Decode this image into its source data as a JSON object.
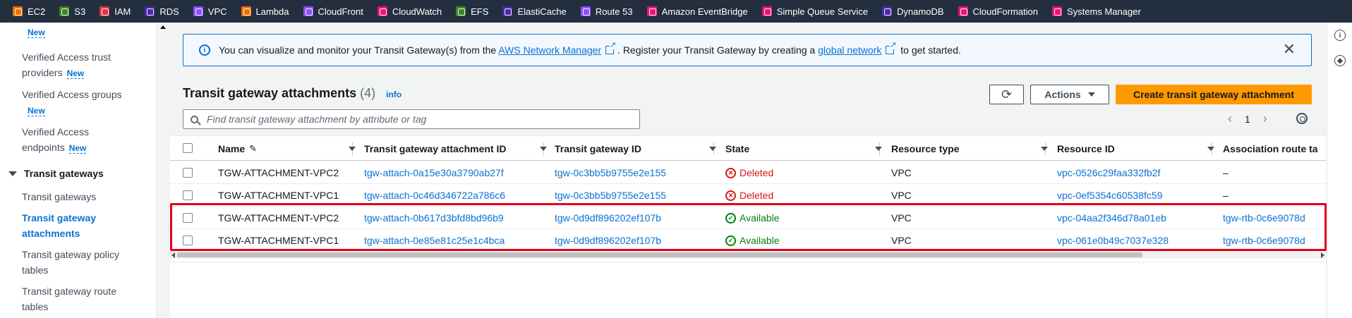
{
  "services": [
    {
      "label": "EC2",
      "color": "#ed7100",
      "icon": "ec2-icon"
    },
    {
      "label": "S3",
      "color": "#3f8624",
      "icon": "s3-icon"
    },
    {
      "label": "IAM",
      "color": "#dd344c",
      "icon": "iam-icon"
    },
    {
      "label": "RDS",
      "color": "#4d27aa",
      "icon": "rds-icon"
    },
    {
      "label": "VPC",
      "color": "#8c4fff",
      "icon": "vpc-icon"
    },
    {
      "label": "Lambda",
      "color": "#ed7100",
      "icon": "lambda-icon"
    },
    {
      "label": "CloudFront",
      "color": "#8c4fff",
      "icon": "cloudfront-icon"
    },
    {
      "label": "CloudWatch",
      "color": "#e7157b",
      "icon": "cloudwatch-icon"
    },
    {
      "label": "EFS",
      "color": "#3f8624",
      "icon": "efs-icon"
    },
    {
      "label": "ElastiCache",
      "color": "#4d27aa",
      "icon": "elasticache-icon"
    },
    {
      "label": "Route 53",
      "color": "#8c4fff",
      "icon": "route53-icon"
    },
    {
      "label": "Amazon EventBridge",
      "color": "#e7157b",
      "icon": "eventbridge-icon"
    },
    {
      "label": "Simple Queue Service",
      "color": "#e7157b",
      "icon": "sqs-icon"
    },
    {
      "label": "DynamoDB",
      "color": "#4d27aa",
      "icon": "dynamodb-icon"
    },
    {
      "label": "CloudFormation",
      "color": "#e7157b",
      "icon": "cloudformation-icon"
    },
    {
      "label": "Systems Manager",
      "color": "#e7157b",
      "icon": "systems-manager-icon"
    }
  ],
  "sidebar": {
    "new_badge": "New",
    "verified_trust_1": "Verified Access trust",
    "verified_trust_2": "providers",
    "verified_groups": "Verified Access groups",
    "verified_endpoints_1": "Verified Access",
    "verified_endpoints_2": "endpoints",
    "section": "Transit gateways",
    "item_tgw": "Transit gateways",
    "item_attach_1": "Transit gateway",
    "item_attach_2": "attachments",
    "item_policy_1": "Transit gateway policy",
    "item_policy_2": "tables",
    "item_route_1": "Transit gateway route",
    "item_route_2": "tables"
  },
  "flash": {
    "text1": "You can visualize and monitor your Transit Gateway(s) from the ",
    "link1": "AWS Network Manager",
    "text2": ". Register your Transit Gateway by creating a ",
    "link2": "global network",
    "text3": " to get started."
  },
  "header": {
    "title": "Transit gateway attachments",
    "count": "(4)",
    "info": "info",
    "actions": "Actions",
    "create": "Create transit gateway attachment"
  },
  "search": {
    "placeholder": "Find transit gateway attachment by attribute or tag"
  },
  "pager": {
    "page": "1"
  },
  "table": {
    "columns": [
      "Name",
      "Transit gateway attachment ID",
      "Transit gateway ID",
      "State",
      "Resource type",
      "Resource ID",
      "Association route ta"
    ],
    "rows": [
      {
        "name": "TGW-ATTACHMENT-VPC2",
        "attach_id": "tgw-attach-0a15e30a3790ab27f",
        "tgw_id": "tgw-0c3bb5b9755e2e155",
        "state": "Deleted",
        "rtype": "VPC",
        "rid": "vpc-0526c29faa332fb2f",
        "assoc": "–"
      },
      {
        "name": "TGW-ATTACHMENT-VPC1",
        "attach_id": "tgw-attach-0c46d346722a786c6",
        "tgw_id": "tgw-0c3bb5b9755e2e155",
        "state": "Deleted",
        "rtype": "VPC",
        "rid": "vpc-0ef5354c60538fc59",
        "assoc": "–"
      },
      {
        "name": "TGW-ATTACHMENT-VPC2",
        "attach_id": "tgw-attach-0b617d3bfd8bd96b9",
        "tgw_id": "tgw-0d9df896202ef107b",
        "state": "Available",
        "rtype": "VPC",
        "rid": "vpc-04aa2f346d78a01eb",
        "assoc": "tgw-rtb-0c6e9078d"
      },
      {
        "name": "TGW-ATTACHMENT-VPC1",
        "attach_id": "tgw-attach-0e85e81c25e1c4bca",
        "tgw_id": "tgw-0d9df896202ef107b",
        "state": "Available",
        "rtype": "VPC",
        "rid": "vpc-061e0b49c7037e328",
        "assoc": "tgw-rtb-0c6e9078d"
      }
    ]
  }
}
